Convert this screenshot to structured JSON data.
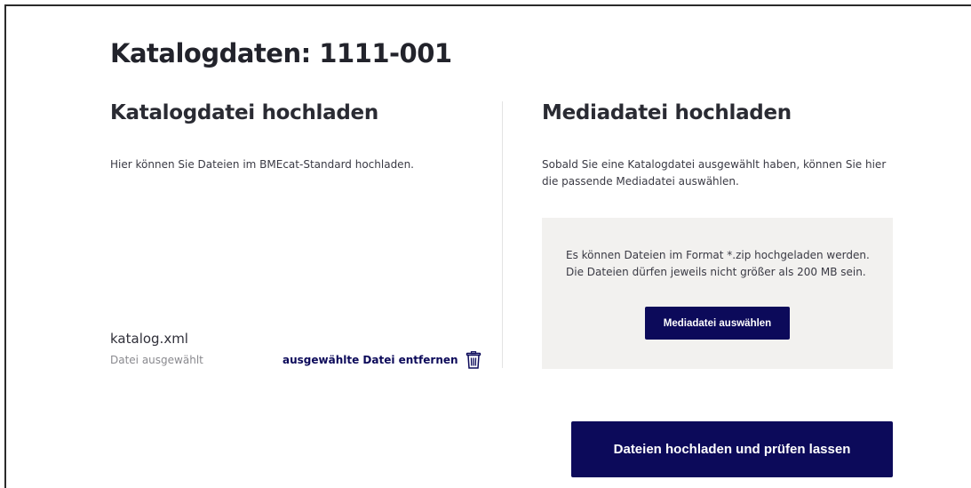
{
  "page": {
    "title": "Katalogdaten: 1111-001"
  },
  "catalog_section": {
    "title": "Katalogdatei hochladen",
    "description": "Hier können Sie Dateien im BMEcat-Standard hochladen.",
    "selected_file": {
      "name": "katalog.xml",
      "status": "Datei ausgewählt",
      "remove_label": "ausgewählte Datei entfernen",
      "remove_icon": "trash-icon"
    }
  },
  "media_section": {
    "title": "Mediadatei hochladen",
    "description_line1": "Sobald Sie eine Katalogdatei ausgewählt haben, können Sie hier",
    "description_line2": "die passende Mediadatei auswählen.",
    "dropzone": {
      "info_line1": "Es können Dateien im Format *.zip hochgeladen werden.",
      "info_line2": "Die Dateien dürfen jeweils nicht größer als 200 MB sein.",
      "button_label": "Mediadatei auswählen"
    }
  },
  "actions": {
    "upload_label": "Dateien hochladen und prüfen lassen"
  },
  "colors": {
    "primary": "#0c0a5a",
    "dropzone_bg": "#f2f1ef",
    "muted_text": "#8a8a8f"
  }
}
